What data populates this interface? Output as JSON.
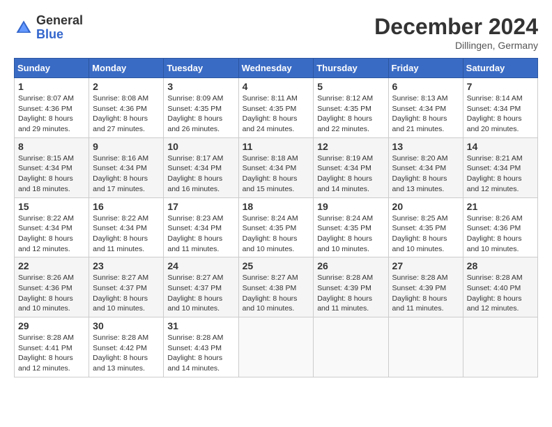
{
  "logo": {
    "general": "General",
    "blue": "Blue"
  },
  "header": {
    "month": "December 2024",
    "location": "Dillingen, Germany"
  },
  "weekdays": [
    "Sunday",
    "Monday",
    "Tuesday",
    "Wednesday",
    "Thursday",
    "Friday",
    "Saturday"
  ],
  "weeks": [
    [
      {
        "day": "1",
        "sunrise": "8:07 AM",
        "sunset": "4:36 PM",
        "daylight": "8 hours and 29 minutes."
      },
      {
        "day": "2",
        "sunrise": "8:08 AM",
        "sunset": "4:36 PM",
        "daylight": "8 hours and 27 minutes."
      },
      {
        "day": "3",
        "sunrise": "8:09 AM",
        "sunset": "4:35 PM",
        "daylight": "8 hours and 26 minutes."
      },
      {
        "day": "4",
        "sunrise": "8:11 AM",
        "sunset": "4:35 PM",
        "daylight": "8 hours and 24 minutes."
      },
      {
        "day": "5",
        "sunrise": "8:12 AM",
        "sunset": "4:35 PM",
        "daylight": "8 hours and 22 minutes."
      },
      {
        "day": "6",
        "sunrise": "8:13 AM",
        "sunset": "4:34 PM",
        "daylight": "8 hours and 21 minutes."
      },
      {
        "day": "7",
        "sunrise": "8:14 AM",
        "sunset": "4:34 PM",
        "daylight": "8 hours and 20 minutes."
      }
    ],
    [
      {
        "day": "8",
        "sunrise": "8:15 AM",
        "sunset": "4:34 PM",
        "daylight": "8 hours and 18 minutes."
      },
      {
        "day": "9",
        "sunrise": "8:16 AM",
        "sunset": "4:34 PM",
        "daylight": "8 hours and 17 minutes."
      },
      {
        "day": "10",
        "sunrise": "8:17 AM",
        "sunset": "4:34 PM",
        "daylight": "8 hours and 16 minutes."
      },
      {
        "day": "11",
        "sunrise": "8:18 AM",
        "sunset": "4:34 PM",
        "daylight": "8 hours and 15 minutes."
      },
      {
        "day": "12",
        "sunrise": "8:19 AM",
        "sunset": "4:34 PM",
        "daylight": "8 hours and 14 minutes."
      },
      {
        "day": "13",
        "sunrise": "8:20 AM",
        "sunset": "4:34 PM",
        "daylight": "8 hours and 13 minutes."
      },
      {
        "day": "14",
        "sunrise": "8:21 AM",
        "sunset": "4:34 PM",
        "daylight": "8 hours and 12 minutes."
      }
    ],
    [
      {
        "day": "15",
        "sunrise": "8:22 AM",
        "sunset": "4:34 PM",
        "daylight": "8 hours and 12 minutes."
      },
      {
        "day": "16",
        "sunrise": "8:22 AM",
        "sunset": "4:34 PM",
        "daylight": "8 hours and 11 minutes."
      },
      {
        "day": "17",
        "sunrise": "8:23 AM",
        "sunset": "4:34 PM",
        "daylight": "8 hours and 11 minutes."
      },
      {
        "day": "18",
        "sunrise": "8:24 AM",
        "sunset": "4:35 PM",
        "daylight": "8 hours and 10 minutes."
      },
      {
        "day": "19",
        "sunrise": "8:24 AM",
        "sunset": "4:35 PM",
        "daylight": "8 hours and 10 minutes."
      },
      {
        "day": "20",
        "sunrise": "8:25 AM",
        "sunset": "4:35 PM",
        "daylight": "8 hours and 10 minutes."
      },
      {
        "day": "21",
        "sunrise": "8:26 AM",
        "sunset": "4:36 PM",
        "daylight": "8 hours and 10 minutes."
      }
    ],
    [
      {
        "day": "22",
        "sunrise": "8:26 AM",
        "sunset": "4:36 PM",
        "daylight": "8 hours and 10 minutes."
      },
      {
        "day": "23",
        "sunrise": "8:27 AM",
        "sunset": "4:37 PM",
        "daylight": "8 hours and 10 minutes."
      },
      {
        "day": "24",
        "sunrise": "8:27 AM",
        "sunset": "4:37 PM",
        "daylight": "8 hours and 10 minutes."
      },
      {
        "day": "25",
        "sunrise": "8:27 AM",
        "sunset": "4:38 PM",
        "daylight": "8 hours and 10 minutes."
      },
      {
        "day": "26",
        "sunrise": "8:28 AM",
        "sunset": "4:39 PM",
        "daylight": "8 hours and 11 minutes."
      },
      {
        "day": "27",
        "sunrise": "8:28 AM",
        "sunset": "4:39 PM",
        "daylight": "8 hours and 11 minutes."
      },
      {
        "day": "28",
        "sunrise": "8:28 AM",
        "sunset": "4:40 PM",
        "daylight": "8 hours and 12 minutes."
      }
    ],
    [
      {
        "day": "29",
        "sunrise": "8:28 AM",
        "sunset": "4:41 PM",
        "daylight": "8 hours and 12 minutes."
      },
      {
        "day": "30",
        "sunrise": "8:28 AM",
        "sunset": "4:42 PM",
        "daylight": "8 hours and 13 minutes."
      },
      {
        "day": "31",
        "sunrise": "8:28 AM",
        "sunset": "4:43 PM",
        "daylight": "8 hours and 14 minutes."
      },
      null,
      null,
      null,
      null
    ]
  ],
  "labels": {
    "sunrise": "Sunrise: ",
    "sunset": "Sunset: ",
    "daylight": "Daylight: "
  }
}
